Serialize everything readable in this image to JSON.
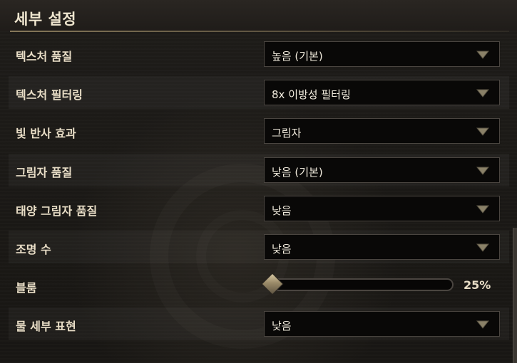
{
  "panel": {
    "title": "세부 설정"
  },
  "settings": [
    {
      "label": "텍스처 품질",
      "type": "dropdown",
      "value": "높음 (기본)"
    },
    {
      "label": "텍스처 필터링",
      "type": "dropdown",
      "value": "8x 이방성 필터링"
    },
    {
      "label": "빛 반사 효과",
      "type": "dropdown",
      "value": "그림자"
    },
    {
      "label": "그림자 품질",
      "type": "dropdown",
      "value": "낮음 (기본)"
    },
    {
      "label": "태양 그림자 품질",
      "type": "dropdown",
      "value": "낮음"
    },
    {
      "label": "조명 수",
      "type": "dropdown",
      "value": "낮음"
    },
    {
      "label": "블룸",
      "type": "slider",
      "value": "25%",
      "level": 0.0
    },
    {
      "label": "물 세부 표현",
      "type": "dropdown",
      "value": "낮음"
    }
  ],
  "icons": {
    "dropdown_arrow": "triangle-down-icon",
    "slider_handle": "diamond-icon"
  },
  "colors": {
    "text": "#e8ddc6",
    "accent": "#a8966e",
    "arrow": "#8a8168"
  }
}
